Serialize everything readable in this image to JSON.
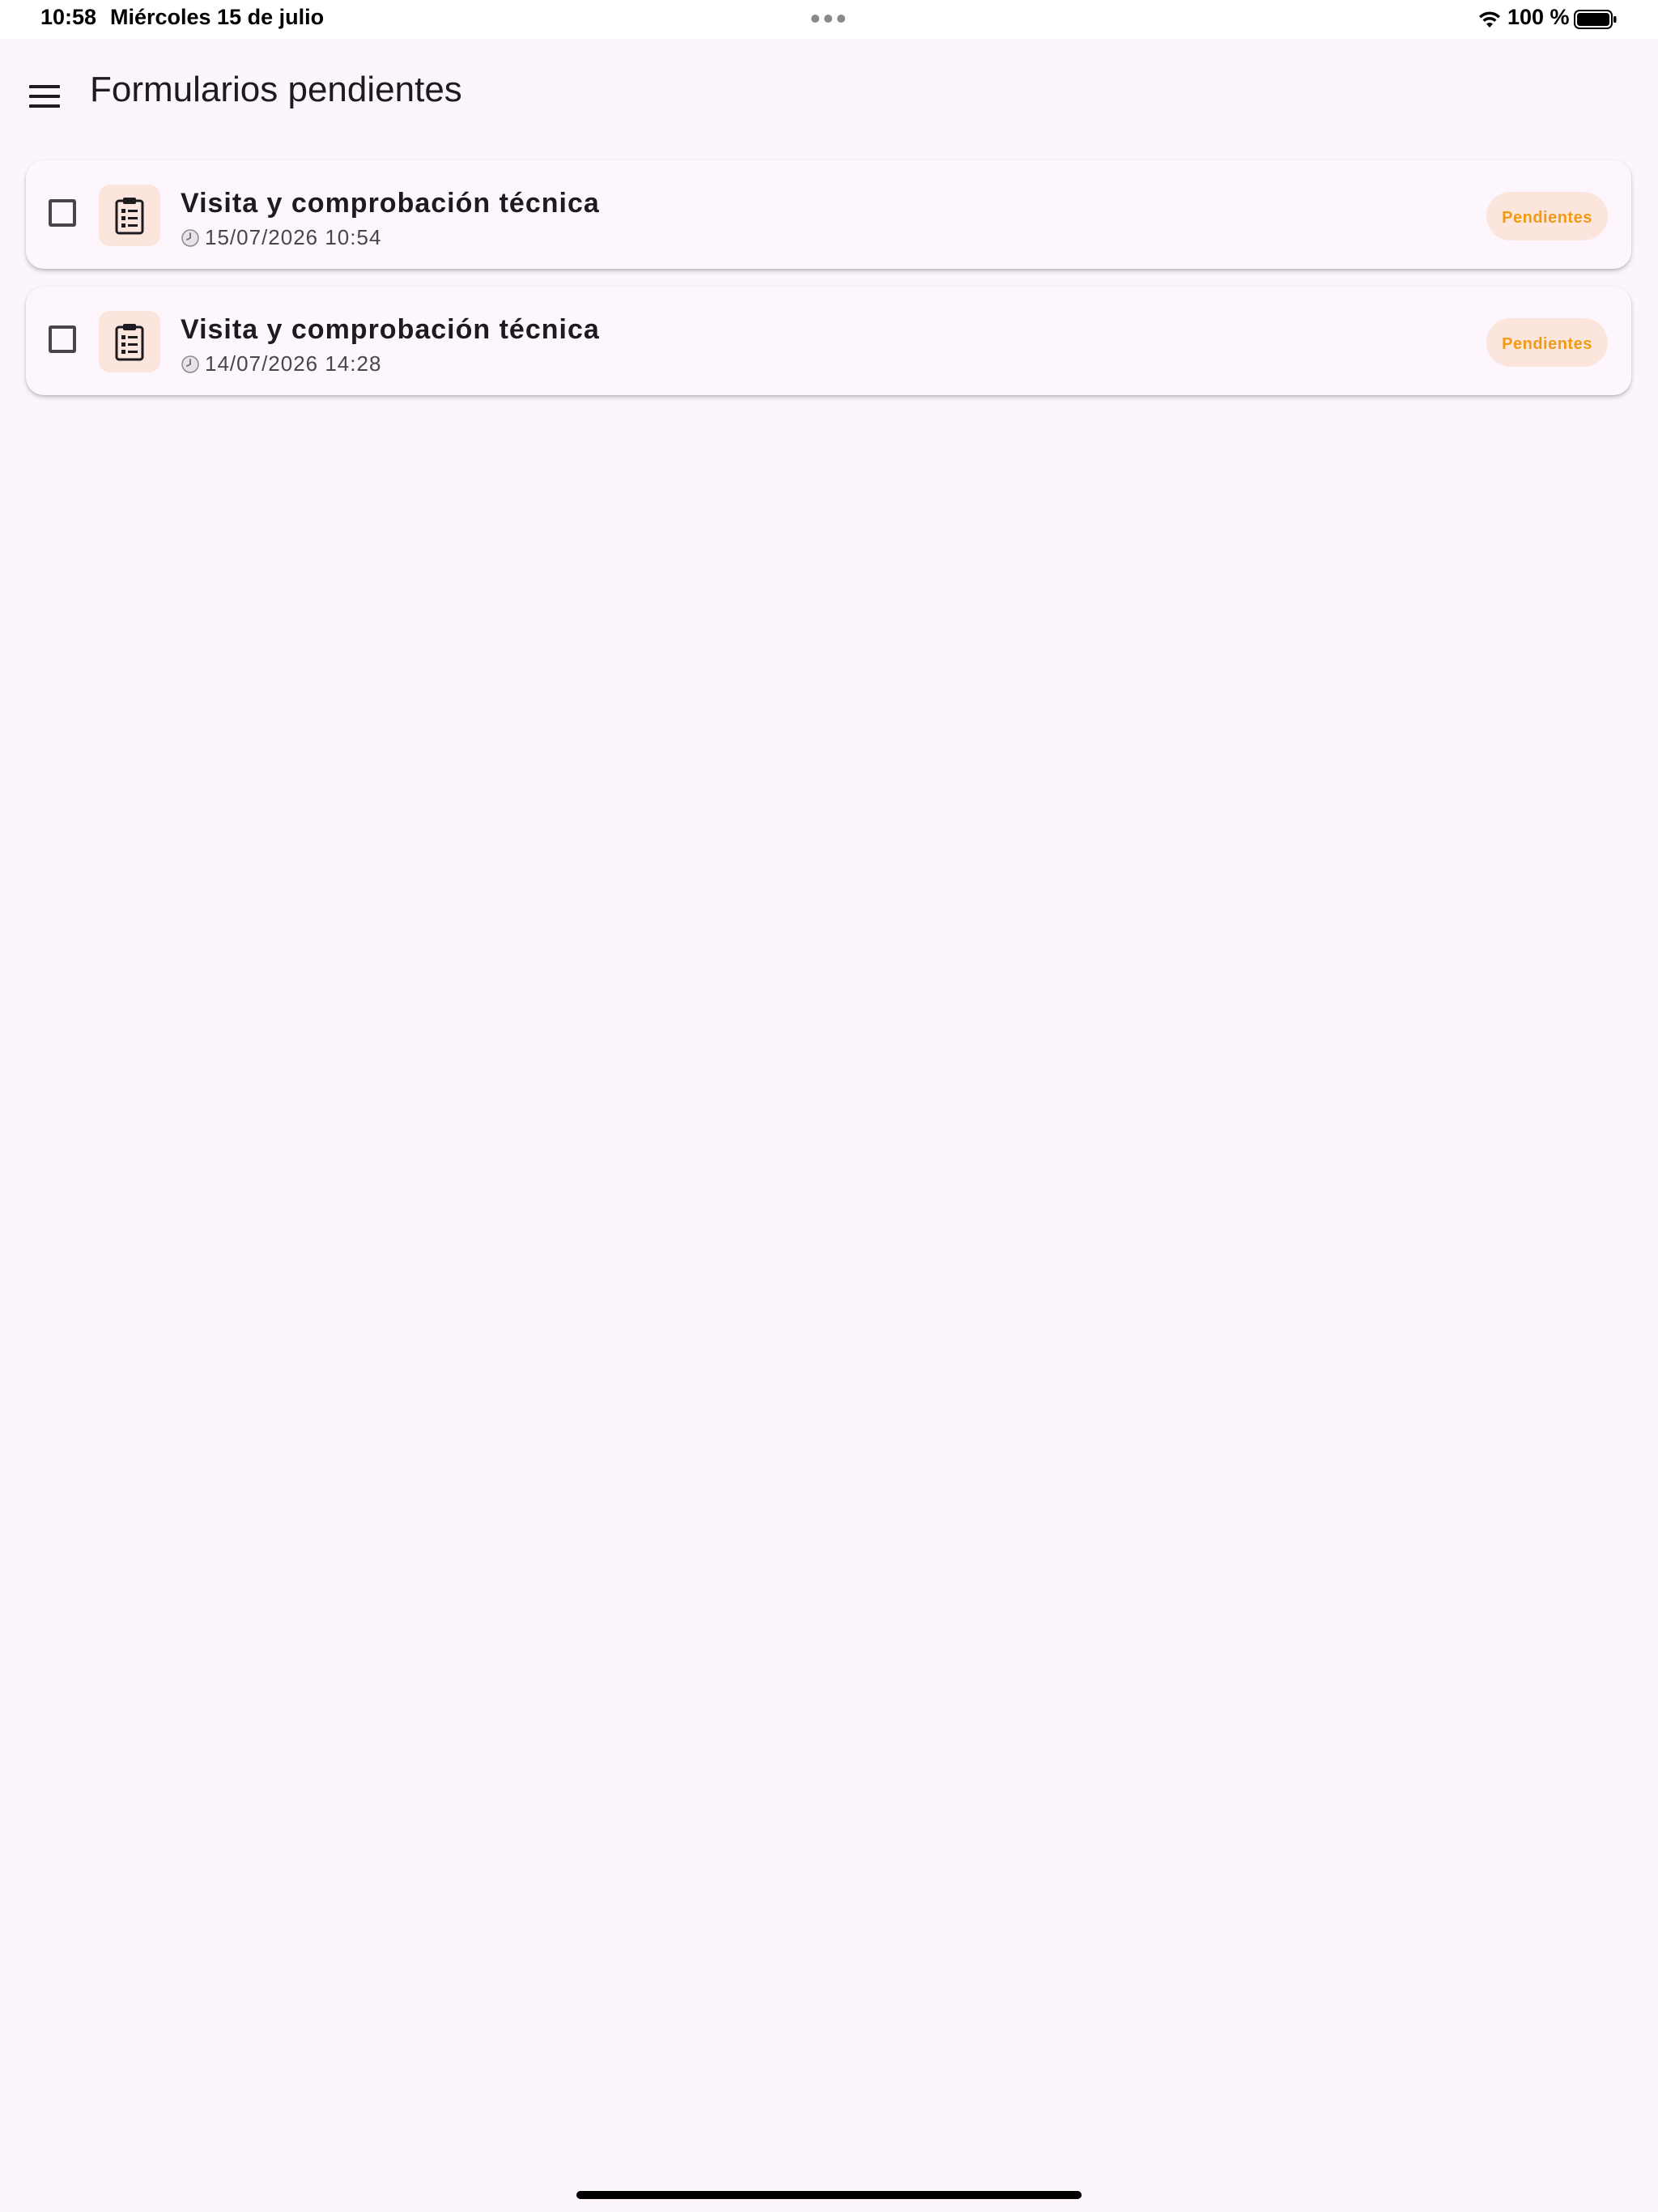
{
  "status_bar": {
    "time": "10:58",
    "date": "Miércoles 15 de julio",
    "battery": "100 %",
    "icons": [
      "wifi-icon",
      "battery-icon"
    ]
  },
  "app_bar": {
    "menu_icon": "menu-icon",
    "title": "Formularios pendientes"
  },
  "forms": [
    {
      "title": "Visita y comprobación técnica",
      "date": "15/07/2026 10:54",
      "status": "Pendientes",
      "checked": false,
      "icon": "clipboard-icon"
    },
    {
      "title": "Visita y comprobación técnica",
      "date": "14/07/2026 14:28",
      "status": "Pendientes",
      "checked": false,
      "icon": "clipboard-icon"
    }
  ],
  "colors": {
    "background": "#fcf5fc",
    "badge_bg": "#fbe5dd",
    "badge_text": "#f29a13",
    "icon_box_bg": "#fbe5dd"
  }
}
